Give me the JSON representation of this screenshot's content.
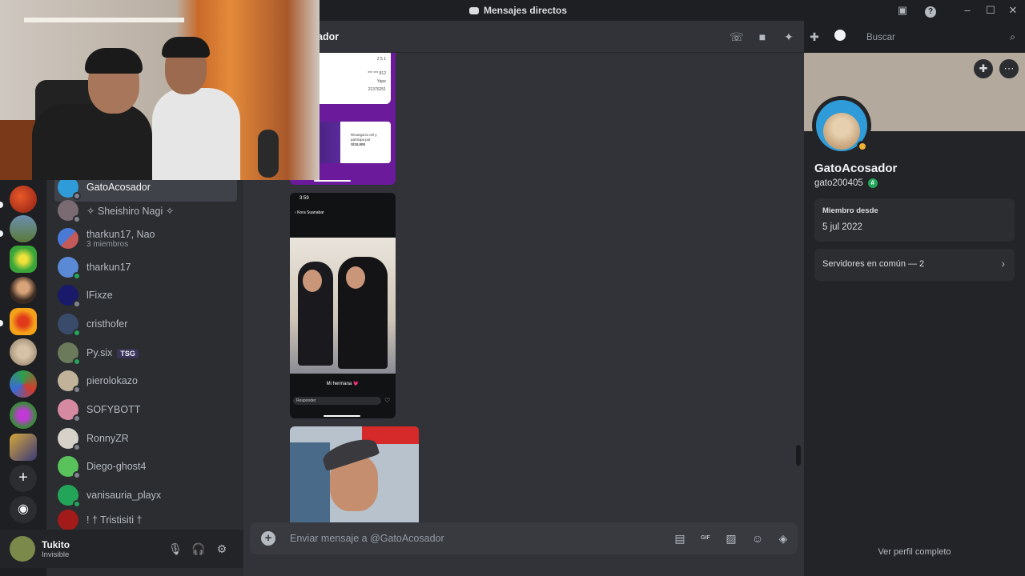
{
  "window": {
    "title": "Mensajes directos",
    "controls": [
      "inbox-icon",
      "help-icon",
      "minimize-icon",
      "maximize-icon",
      "close-icon"
    ]
  },
  "guilds": {
    "items": [
      "server-red",
      "server-landscape",
      "server-green-character",
      "server-anime",
      "server-orange",
      "server-cat",
      "server-colorful",
      "server-purple-character",
      "server-pixel"
    ],
    "add_server": "+",
    "discover": "compass-icon"
  },
  "dm_list": {
    "items": [
      {
        "name": "GatoAcosador",
        "sub": "",
        "selected": true
      },
      {
        "name": "✧ Sheishiro Nagi ✧",
        "sub": ""
      },
      {
        "name": "tharkun17, Nao",
        "sub": "3 miembros"
      },
      {
        "name": "tharkun17",
        "sub": ""
      },
      {
        "name": "lFixze",
        "sub": ""
      },
      {
        "name": "cristhofer",
        "sub": ""
      },
      {
        "name": "Py.six",
        "sub": "",
        "tag": "TSG"
      },
      {
        "name": "pierolokazo",
        "sub": ""
      },
      {
        "name": "SOFYBOTT",
        "sub": ""
      },
      {
        "name": "RonnyZR",
        "sub": ""
      },
      {
        "name": "Diego-ghost4",
        "sub": ""
      },
      {
        "name": "vanisauria_playx",
        "sub": ""
      },
      {
        "name": "! † Tristisiti †",
        "sub": ""
      }
    ]
  },
  "user_panel": {
    "name": "Tukito",
    "status": "Invisible"
  },
  "chat": {
    "header_name": "GatoAcosador",
    "header_name_visible": "ador",
    "search_placeholder": "Buscar",
    "composer_placeholder": "Enviar mensaje a @GatoAcosador",
    "attachments": {
      "story_time": "3:59",
      "story_user": "Kora Suanabar",
      "story_caption": "Mi hermana 💗",
      "story_reply": "Responder",
      "receipt_rows": [
        "2 5 1",
        "*** *** 812",
        "Yape",
        "21376251"
      ],
      "promo_text": "Recarga tu cel y participa por",
      "promo_amount": "S/10,000"
    }
  },
  "profile": {
    "display_name": "GatoAcosador",
    "username": "gato200405",
    "member_since_label": "Miembro desde",
    "member_since_value": "5 jul 2022",
    "mutual_servers": "Servidores en común — 2",
    "full_profile": "Ver perfil completo"
  },
  "colors": {
    "background": "#313338",
    "sidebar": "#2b2d31",
    "guild_bar": "#1e1f22",
    "panel": "#232428",
    "online": "#23a559",
    "idle": "#f0b232"
  }
}
